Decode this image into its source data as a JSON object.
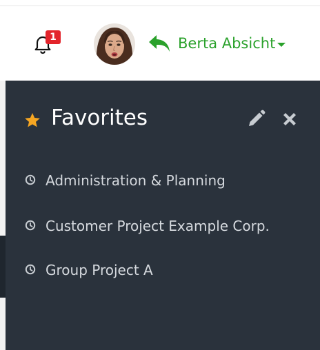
{
  "header": {
    "notifications": {
      "count": "1",
      "icon": "bell-icon"
    },
    "user": {
      "name": "Berta Absicht",
      "icon": "reply-icon",
      "color": "#2aa12b"
    }
  },
  "favorites": {
    "title": "Favorites",
    "star_color": "#f5a623",
    "items": [
      {
        "label": "Administration & Planning",
        "icon": "clock-icon"
      },
      {
        "label": "Customer Project Example Corp.",
        "icon": "clock-icon"
      },
      {
        "label": "Group Project A",
        "icon": "clock-icon"
      }
    ]
  },
  "colors": {
    "panel_background": "#2a323c",
    "badge": "#e3242b",
    "text_light": "#d5d9de"
  }
}
